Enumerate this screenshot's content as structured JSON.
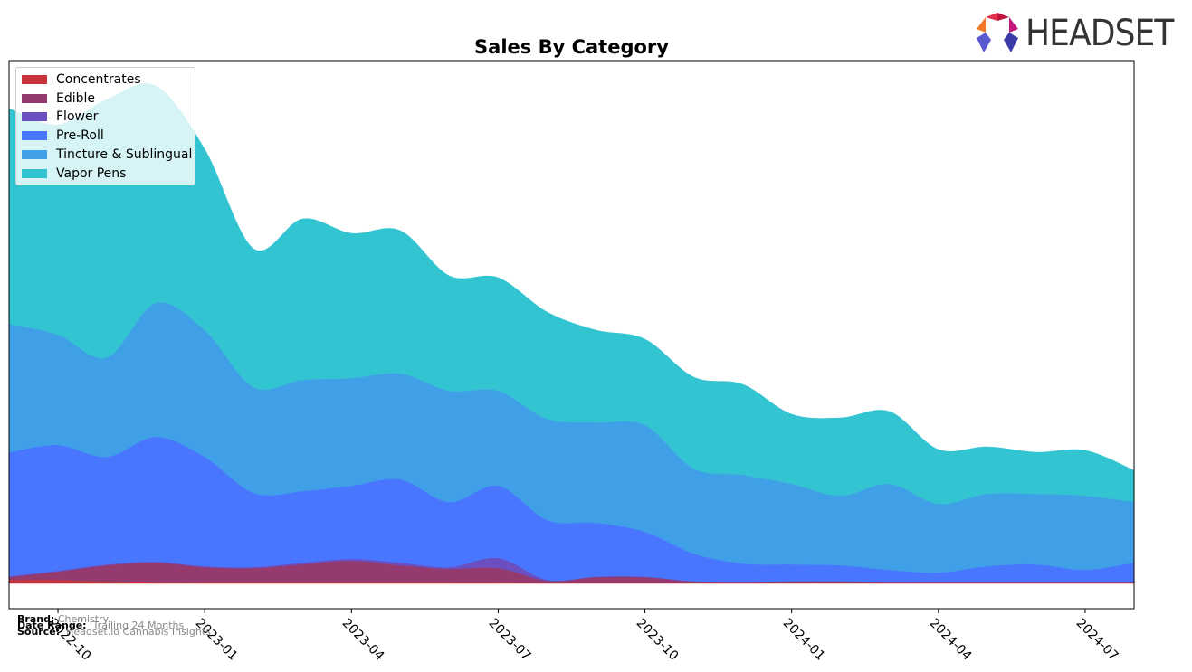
{
  "chart_data": {
    "type": "area",
    "stacked": true,
    "title": "Sales By Category",
    "xlabel": "",
    "ylabel": "",
    "x": [
      "2022-09",
      "2022-10",
      "2022-11",
      "2022-12",
      "2023-01",
      "2023-02",
      "2023-03",
      "2023-04",
      "2023-05",
      "2023-06",
      "2023-07",
      "2023-08",
      "2023-09",
      "2023-10",
      "2023-11",
      "2023-12",
      "2024-01",
      "2024-02",
      "2024-03",
      "2024-04",
      "2024-05",
      "2024-06",
      "2024-07",
      "2024-08"
    ],
    "x_tick_labels": [
      "2022-10",
      "2023-01",
      "2023-04",
      "2023-07",
      "2023-10",
      "2024-01",
      "2024-04",
      "2024-07"
    ],
    "y_ticks_shown": false,
    "grid": false,
    "legend_placement": "top-left",
    "series": [
      {
        "name": "Concentrates",
        "color": "#c8343a",
        "values": [
          4,
          4,
          2,
          1,
          1,
          1,
          1,
          1,
          1,
          1,
          1,
          0.5,
          0.5,
          0.5,
          0.5,
          0.5,
          0.5,
          0.5,
          0.5,
          0.5,
          0.5,
          0.5,
          0.5,
          0.5
        ]
      },
      {
        "name": "Edible",
        "color": "#943a6e",
        "values": [
          3,
          9,
          18,
          22,
          17,
          16,
          20,
          24,
          19,
          15,
          16,
          2.5,
          6.5,
          6.5,
          1.5,
          0.5,
          1.5,
          1.5,
          0.5,
          0.5,
          0.5,
          0.5,
          0.5,
          0.5
        ]
      },
      {
        "name": "Flower",
        "color": "#6b4fc0",
        "values": [
          1,
          1,
          1,
          1,
          1,
          1,
          2,
          2,
          3,
          2,
          11,
          1,
          0.5,
          0.5,
          0.5,
          0.5,
          0.5,
          0.5,
          0.5,
          0.5,
          0.5,
          0.5,
          0.5,
          0.5
        ]
      },
      {
        "name": "Pre-Roll",
        "color": "#4876ff",
        "values": [
          137,
          139,
          119,
          138,
          121,
          82,
          79,
          81,
          92,
          72,
          80,
          66,
          59.5,
          49.5,
          30.5,
          20.5,
          18.5,
          17.5,
          13.5,
          10.5,
          17.5,
          19.5,
          13.5,
          21.5
        ]
      },
      {
        "name": "Tincture & Sublingual",
        "color": "#3fa0e8",
        "values": [
          142,
          122,
          110,
          148,
          140,
          117,
          123,
          119,
          117,
          123,
          105,
          112,
          111,
          118,
          94,
          98,
          89,
          77,
          95,
          76,
          80,
          78,
          82,
          67
        ]
      },
      {
        "name": "Vapor Pens",
        "color": "#33c4d2",
        "values": [
          238,
          232,
          285,
          240,
          200,
          153,
          178,
          160,
          158,
          127,
          125,
          118,
          102,
          95,
          101,
          100,
          77,
          86,
          80,
          60,
          52,
          46,
          50,
          35
        ]
      }
    ]
  },
  "footer": {
    "brand_label": "Brand:",
    "brand_value": "Chemistry",
    "date_label": "Date Range:",
    "date_value": "Trailing 24 Months",
    "source_label": "Source:",
    "source_value": "Headset.io Cannabis Insights"
  },
  "logo": {
    "text": "HEADSET"
  }
}
